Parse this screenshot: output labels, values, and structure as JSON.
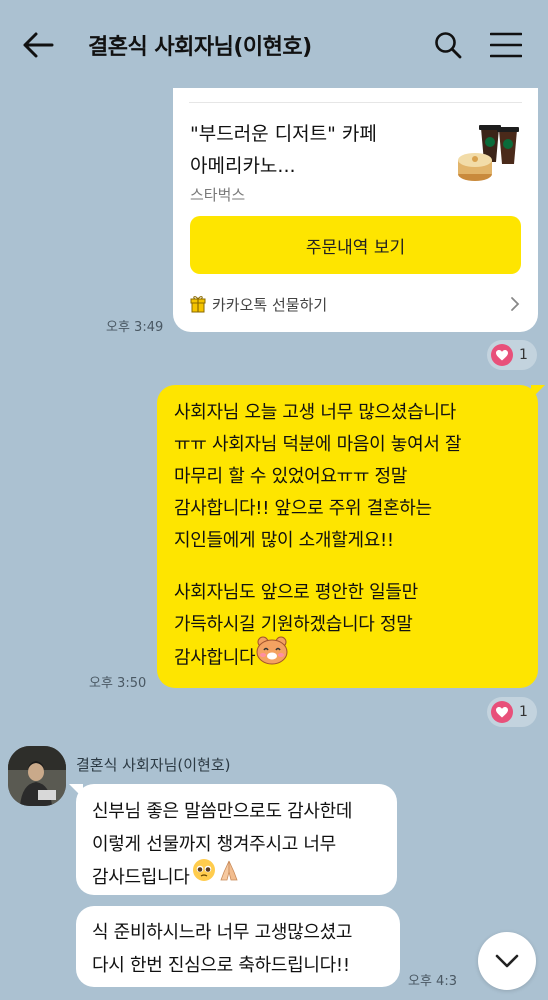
{
  "header": {
    "title": "결혼식 사회자님(이현호)",
    "back_icon": "arrow-left-icon",
    "search_icon": "search-icon",
    "menu_icon": "hamburger-menu-icon"
  },
  "gift": {
    "name_line1": "\"부드러운 디저트\" 카페",
    "name_line2": "아메리카노...",
    "brand": "스타벅스",
    "order_button": "주문내역 보기",
    "footer": "카카오톡 선물하기",
    "time": "오후 3:49",
    "reaction_count": "1"
  },
  "my_message": {
    "lines": [
      "사회자님 오늘 고생 너무 많으셨습니다",
      "ㅠㅠ 사회자님 덕분에 마음이 놓여서 잘",
      "마무리 할 수 있었어요ㅠㅠ 정말",
      "감사합니다!! 앞으로 주위 결혼하는",
      "지인들에게 많이 소개할게요!!",
      "사회자님도 앞으로 평안한 일들만",
      "가득하시길 기원하겠습니다 정말",
      "감사합니다"
    ],
    "time": "오후 3:50",
    "reaction_count": "1"
  },
  "sender": {
    "name": "결혼식 사회자님(이현호)"
  },
  "reply1": {
    "lines": [
      "신부님 좋은 말씀만으로도 감사한데",
      "이렇게 선물까지 챙겨주시고 너무",
      "감사드립니다"
    ]
  },
  "reply2": {
    "lines": [
      "식 준비하시느라 너무 고생많으셨고",
      "다시 한번 진심으로 축하드립니다!!"
    ],
    "time": "오후 4:3"
  },
  "colors": {
    "background": "#abc1d1",
    "my_bubble": "#fee500",
    "other_bubble": "#ffffff",
    "heart": "#e8507a"
  }
}
